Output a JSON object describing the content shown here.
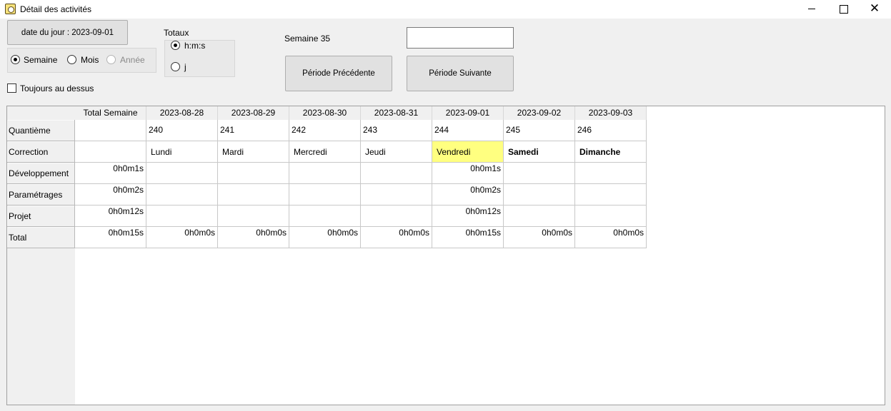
{
  "window": {
    "title": "Détail des activités",
    "minimize_glyph": "",
    "maximize_glyph": "",
    "close_glyph": "✕"
  },
  "toolbar": {
    "date_button": "date du jour : 2023-09-01",
    "period_radios": [
      {
        "label": "Semaine",
        "checked": true,
        "enabled": true
      },
      {
        "label": "Mois",
        "checked": false,
        "enabled": true
      },
      {
        "label": "Année",
        "checked": false,
        "enabled": false
      }
    ],
    "totals_title": "Totaux",
    "totals_radios": [
      {
        "label": "h:m:s",
        "checked": true
      },
      {
        "label": "j",
        "checked": false
      }
    ],
    "always_on_top": {
      "label": "Toujours au dessus",
      "checked": false
    },
    "week_label": "Semaine 35",
    "search_value": "",
    "prev_button": "Période Précédente",
    "next_button": "Période Suivante"
  },
  "grid": {
    "columns": [
      "Total Semaine",
      "2023-08-28",
      "2023-08-29",
      "2023-08-30",
      "2023-08-31",
      "2023-09-01",
      "2023-09-02",
      "2023-09-03"
    ],
    "rows": [
      {
        "label": "Quantième",
        "cells": [
          "",
          "240",
          "241",
          "242",
          "243",
          "244",
          "245",
          "246"
        ]
      },
      {
        "label": "Correction",
        "cells": [
          "",
          "Lundi",
          "Mardi",
          "Mercredi",
          "Jeudi",
          "Vendredi",
          "Samedi",
          "Dimanche"
        ]
      },
      {
        "label": "Développement",
        "cells": [
          "0h0m1s",
          "",
          "",
          "",
          "",
          "0h0m1s",
          "",
          ""
        ]
      },
      {
        "label": "Paramétrages",
        "cells": [
          "0h0m2s",
          "",
          "",
          "",
          "",
          "0h0m2s",
          "",
          ""
        ]
      },
      {
        "label": "Projet",
        "cells": [
          "0h0m12s",
          "",
          "",
          "",
          "",
          "0h0m12s",
          "",
          ""
        ]
      },
      {
        "label": "Total",
        "cells": [
          "0h0m15s",
          "0h0m0s",
          "0h0m0s",
          "0h0m0s",
          "0h0m0s",
          "0h0m15s",
          "0h0m0s",
          "0h0m0s"
        ]
      }
    ],
    "today_highlight_color": "#ffff80"
  }
}
